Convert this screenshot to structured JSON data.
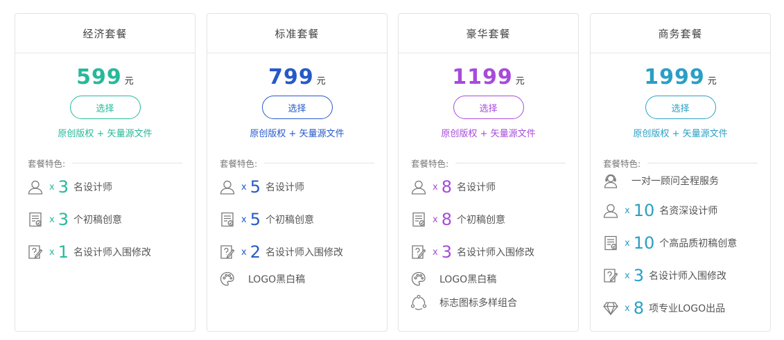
{
  "colors": {
    "economy": "#26b99a",
    "standard": "#2559c9",
    "deluxe": "#a64bdb",
    "business": "#2a9fc4"
  },
  "feature_section_label": "套餐特色:",
  "multiplier": "x",
  "plans": [
    {
      "title": "经济套餐",
      "price": "599",
      "unit": "元",
      "select_label": "选择",
      "rights": "原创版权 + 矢量源文件",
      "features": [
        {
          "icon": "user-icon",
          "qty": "3",
          "label": "名设计师"
        },
        {
          "icon": "draft-icon",
          "qty": "3",
          "label": "个初稿创意"
        },
        {
          "icon": "edit-icon",
          "qty": "1",
          "label": "名设计师入围修改"
        }
      ]
    },
    {
      "title": "标准套餐",
      "price": "799",
      "unit": "元",
      "select_label": "选择",
      "rights": "原创版权 + 矢量源文件",
      "features": [
        {
          "icon": "user-icon",
          "qty": "5",
          "label": "名设计师"
        },
        {
          "icon": "draft-icon",
          "qty": "5",
          "label": "个初稿创意"
        },
        {
          "icon": "edit-icon",
          "qty": "2",
          "label": "名设计师入围修改"
        },
        {
          "icon": "palette-icon",
          "label": "LOGO黑白稿"
        }
      ]
    },
    {
      "title": "豪华套餐",
      "price": "1199",
      "unit": "元",
      "select_label": "选择",
      "rights": "原创版权 + 矢量源文件",
      "features": [
        {
          "icon": "user-icon",
          "qty": "8",
          "label": "名设计师"
        },
        {
          "icon": "draft-icon",
          "qty": "8",
          "label": "个初稿创意"
        },
        {
          "icon": "edit-icon",
          "qty": "3",
          "label": "名设计师入围修改"
        },
        {
          "icon": "palette-icon",
          "label": "LOGO黑白稿"
        },
        {
          "icon": "share-icon",
          "label": "标志图标多样组合"
        }
      ]
    },
    {
      "title": "商务套餐",
      "price": "1999",
      "unit": "元",
      "select_label": "选择",
      "rights": "原创版权 + 矢量源文件",
      "features": [
        {
          "icon": "consultant-icon",
          "label": "一对一顾问全程服务"
        },
        {
          "icon": "user-icon",
          "qty": "10",
          "label": "名资深设计师"
        },
        {
          "icon": "draft-icon",
          "qty": "10",
          "label": "个高品质初稿创意"
        },
        {
          "icon": "edit-icon",
          "qty": "3",
          "label": "名设计师入围修改"
        },
        {
          "icon": "diamond-icon",
          "qty": "8",
          "label": "项专业LOGO出品"
        }
      ]
    }
  ]
}
